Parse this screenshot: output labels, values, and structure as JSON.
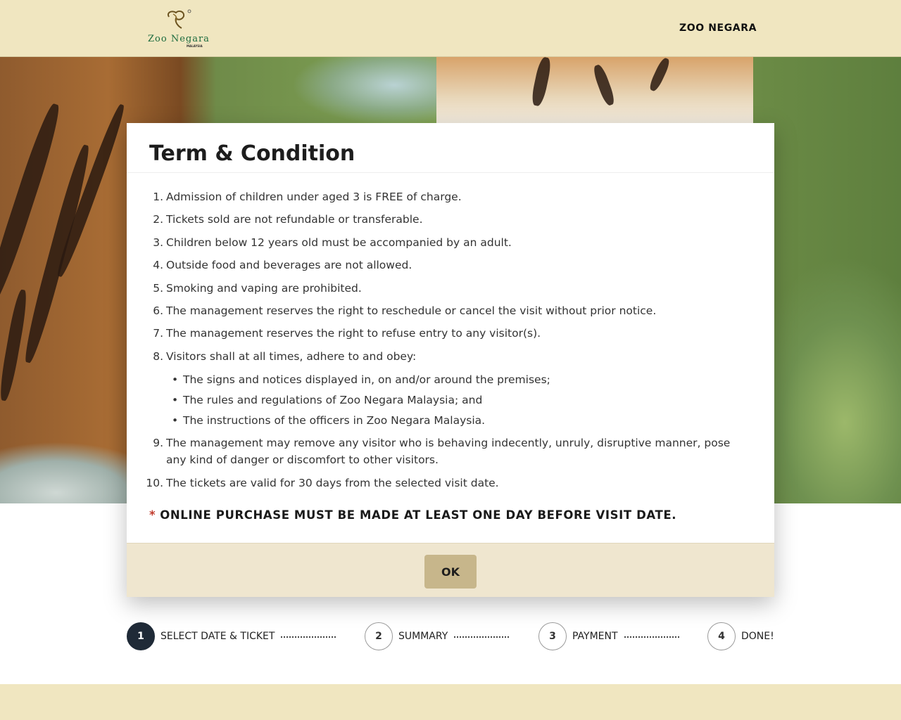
{
  "header": {
    "brand_name": "Zoo Negara",
    "brand_sub": "MALAYSIA",
    "nav_title": "ZOO NEGARA"
  },
  "modal": {
    "title": "Term & Condition",
    "terms": [
      {
        "num": "1.",
        "text": "Admission of children under aged 3 is FREE of charge."
      },
      {
        "num": "2.",
        "text": "Tickets sold are not refundable or transferable."
      },
      {
        "num": "3.",
        "text": "Children below 12 years old must be accompanied by an adult."
      },
      {
        "num": "4.",
        "text": "Outside food and beverages are not allowed."
      },
      {
        "num": "5.",
        "text": "Smoking and vaping are prohibited."
      },
      {
        "num": "6.",
        "text": "The management reserves the right to reschedule or cancel the visit without prior notice."
      },
      {
        "num": "7.",
        "text": "The management reserves the right to refuse entry to any visitor(s)."
      },
      {
        "num": "8.",
        "text": "Visitors shall at all times, adhere to and obey:",
        "sub": [
          "The signs and notices displayed in, on and/or around the premises;",
          "The rules and regulations of Zoo Negara Malaysia; and",
          "The instructions of the officers in Zoo Negara Malaysia."
        ]
      },
      {
        "num": "9.",
        "text": "The management may remove any visitor who is behaving indecently, unruly, disruptive manner, pose any kind of danger or discomfort to other visitors."
      },
      {
        "num": "10.",
        "text": "The tickets are valid for 30 days from the selected visit date."
      }
    ],
    "notice_star": "*",
    "notice": "ONLINE PURCHASE MUST BE MADE AT LEAST ONE DAY BEFORE VISIT DATE.",
    "ok_label": "OK"
  },
  "steps": [
    {
      "number": "1",
      "label": "SELECT DATE & TICKET",
      "active": true
    },
    {
      "number": "2",
      "label": "SUMMARY",
      "active": false
    },
    {
      "number": "3",
      "label": "PAYMENT",
      "active": false
    },
    {
      "number": "4",
      "label": "DONE!",
      "active": false
    }
  ],
  "colors": {
    "header_bg": "#f0e6c0",
    "ok_button": "#c7b68b",
    "active_step": "#1f2a37",
    "notice_star": "#c0392b"
  }
}
